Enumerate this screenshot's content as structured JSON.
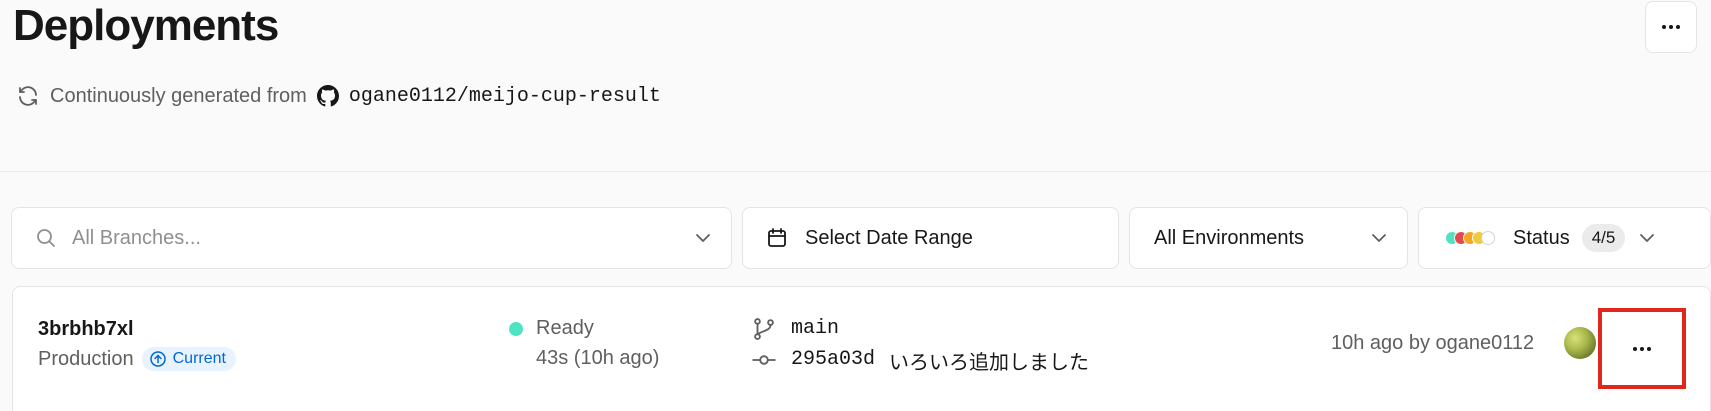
{
  "header": {
    "title": "Deployments",
    "source_prefix": "Continuously generated from",
    "repo": "ogane0112/meijo-cup-result"
  },
  "filters": {
    "branches_placeholder": "All Branches...",
    "date_label": "Select Date Range",
    "environment_label": "All Environments",
    "status_label": "Status",
    "status_count": "4/5",
    "status_colors": [
      "#50e3c2",
      "#e5484d",
      "#f5a623",
      "#f0c93c",
      "#ffffff"
    ]
  },
  "deployments": [
    {
      "id": "3brbhb7xl",
      "environment": "Production",
      "badge": "Current",
      "status": "Ready",
      "status_color": "#50e3c2",
      "duration": "43s (10h ago)",
      "branch": "main",
      "commit_hash": "295a03d",
      "commit_message": "いろいろ追加しました",
      "time_author": "10h ago by ogane0112"
    }
  ],
  "icons": {
    "refresh": "refresh-icon",
    "github": "github-icon",
    "search": "search-icon",
    "calendar": "calendar-icon",
    "chevron": "chevron-down-icon",
    "branch": "git-branch-icon",
    "commit": "git-commit-icon",
    "more": "more-horizontal-icon"
  },
  "colors": {
    "accent_blue": "#0068d6",
    "ready_green": "#50e3c2",
    "highlight_red": "#e1261c"
  }
}
